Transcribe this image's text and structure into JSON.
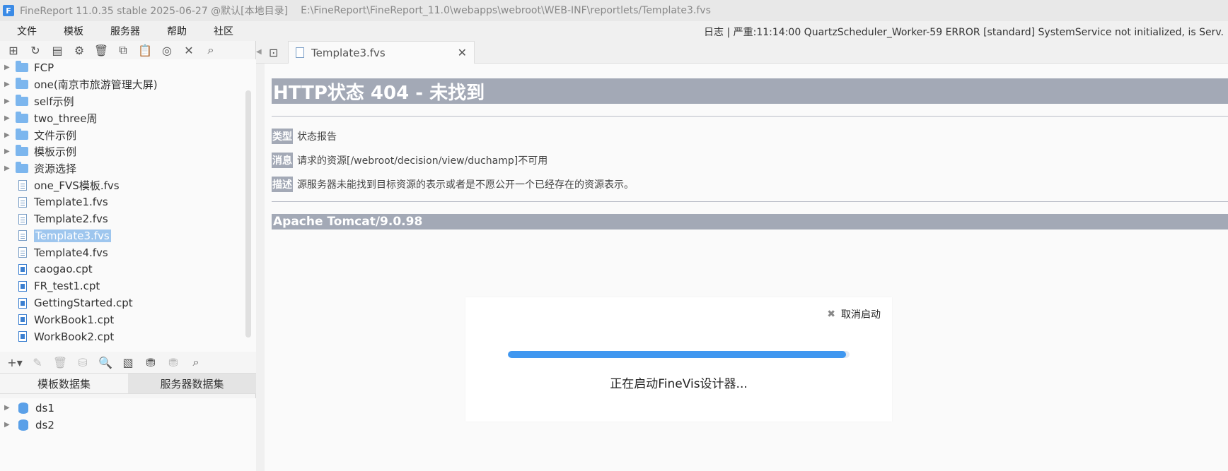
{
  "titlebar": {
    "logo": "F",
    "title": "FineReport 11.0.35 stable 2025-06-27 @默认[本地目录]",
    "path": "E:\\FineReport\\FineReport_11.0\\webapps\\webroot\\WEB-INF\\reportlets/Template3.fvs"
  },
  "menu": [
    "文件",
    "模板",
    "服务器",
    "帮助",
    "社区"
  ],
  "log": "日志 | 严重:11:14:00 QuartzScheduler_Worker-59 ERROR [standard] SystemService not initialized, is Serv.",
  "tree": [
    {
      "label": "FCP",
      "type": "folder"
    },
    {
      "label": "one(南京市旅游管理大屏)",
      "type": "folder"
    },
    {
      "label": "self示例",
      "type": "folder"
    },
    {
      "label": "two_three周",
      "type": "folder"
    },
    {
      "label": "文件示例",
      "type": "folder"
    },
    {
      "label": "模板示例",
      "type": "folder"
    },
    {
      "label": "资源选择",
      "type": "folder"
    },
    {
      "label": "one_FVS模板.fvs",
      "type": "fvs"
    },
    {
      "label": "Template1.fvs",
      "type": "fvs"
    },
    {
      "label": "Template2.fvs",
      "type": "fvs"
    },
    {
      "label": "Template3.fvs",
      "type": "fvs",
      "selected": true
    },
    {
      "label": "Template4.fvs",
      "type": "fvs"
    },
    {
      "label": "caogao.cpt",
      "type": "cpt"
    },
    {
      "label": "FR_test1.cpt",
      "type": "cpt"
    },
    {
      "label": "GettingStarted.cpt",
      "type": "cpt"
    },
    {
      "label": "WorkBook1.cpt",
      "type": "cpt"
    },
    {
      "label": "WorkBook2.cpt",
      "type": "cpt"
    }
  ],
  "dataset_tabs": {
    "template": "模板数据集",
    "server": "服务器数据集"
  },
  "datasets": [
    "ds1",
    "ds2"
  ],
  "doc_tab": {
    "label": "Template3.fvs"
  },
  "error_page": {
    "title": "HTTP状态 404 - 未找到",
    "type_key": "类型",
    "type_val": "状态报告",
    "msg_key": "消息",
    "msg_val": "请求的资源[/webroot/decision/view/duchamp]不可用",
    "desc_key": "描述",
    "desc_val": "源服务器未能找到目标资源的表示或者是不愿公开一个已经存在的资源表示。",
    "footer": "Apache Tomcat/9.0.98"
  },
  "dialog": {
    "cancel_label": "取消启动",
    "loading": "正在启动FineVis设计器...",
    "progress": 0.99
  },
  "colors": {
    "accent": "#3f97f0",
    "error_header": "#a3a9b6"
  }
}
